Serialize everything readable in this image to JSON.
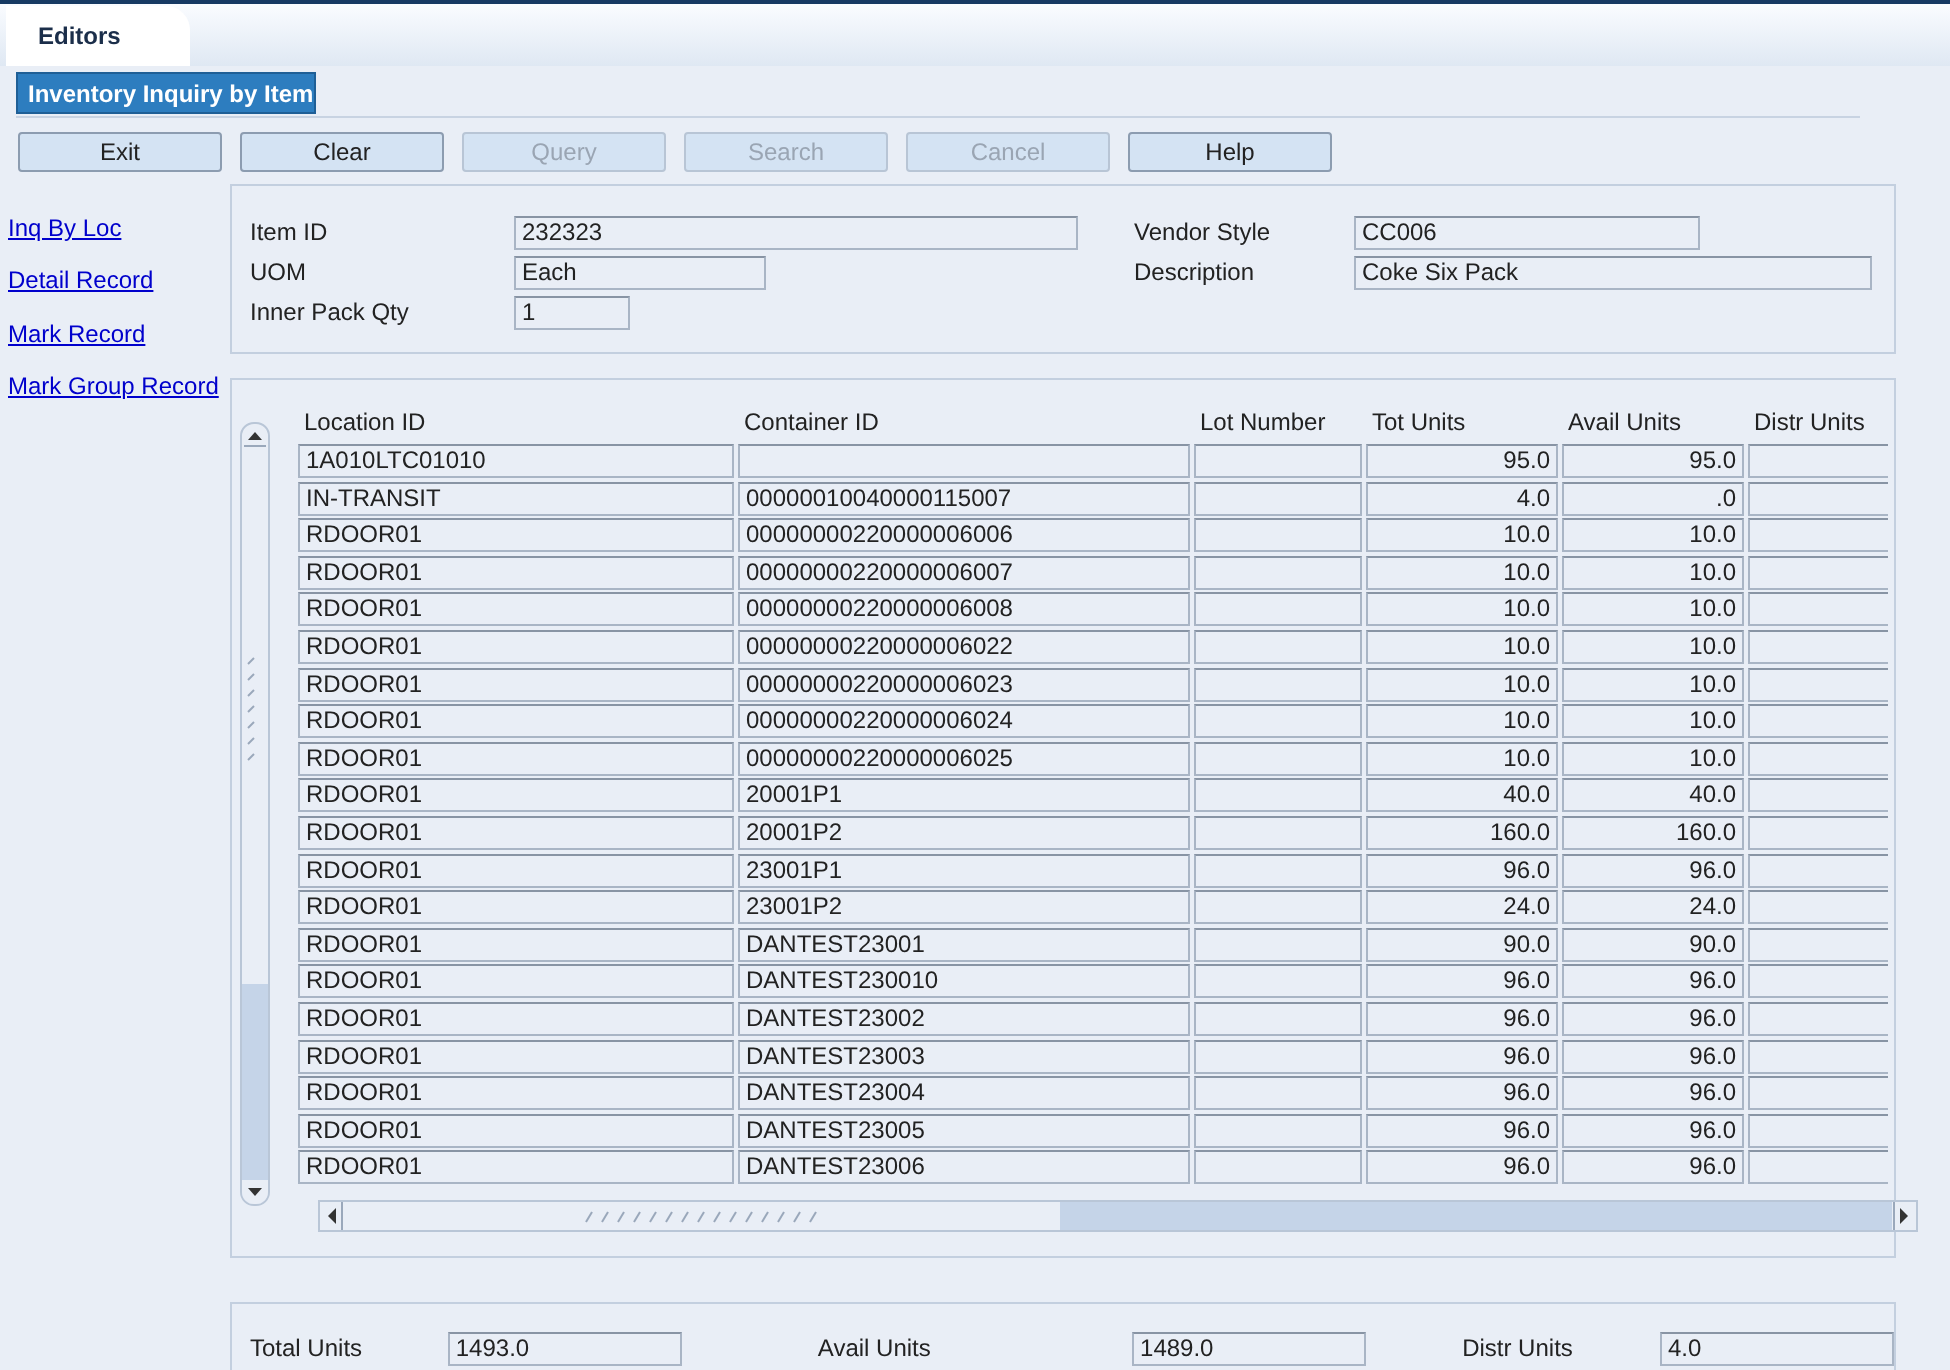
{
  "tabs": [
    {
      "label": "Editors",
      "selected": true
    }
  ],
  "form_title": "Inventory Inquiry by Item",
  "buttons": [
    {
      "label": "Exit",
      "disabled": false
    },
    {
      "label": "Clear",
      "disabled": false
    },
    {
      "label": "Query",
      "disabled": true
    },
    {
      "label": "Search",
      "disabled": true
    },
    {
      "label": "Cancel",
      "disabled": true
    },
    {
      "label": "Help",
      "disabled": false
    }
  ],
  "side_links": [
    "Inq By Loc",
    "Detail Record",
    "Mark Record",
    "Mark Group Record"
  ],
  "header": {
    "item_id": {
      "label": "Item ID",
      "value": "232323"
    },
    "uom": {
      "label": "UOM",
      "value": "Each"
    },
    "inner_pack_qty": {
      "label": "Inner Pack Qty",
      "value": "1"
    },
    "vendor_style": {
      "label": "Vendor Style",
      "value": "CC006"
    },
    "description": {
      "label": "Description",
      "value": "Coke Six Pack"
    }
  },
  "table": {
    "columns": [
      "Location ID",
      "Container ID",
      "Lot Number",
      "Tot Units",
      "Avail Units",
      "Distr Units"
    ],
    "rows": [
      {
        "location_id": "1A010LTC01010",
        "tot_units": "95.0",
        "avail_units": "95.0"
      },
      {
        "location_id": "IN-TRANSIT",
        "container_id": "00000010040000115007",
        "tot_units": "4.0",
        "avail_units": ".0"
      },
      {
        "location_id": "RDOOR01",
        "container_id": "00000000220000006006",
        "tot_units": "10.0",
        "avail_units": "10.0"
      },
      {
        "location_id": "RDOOR01",
        "container_id": "00000000220000006007",
        "tot_units": "10.0",
        "avail_units": "10.0"
      },
      {
        "location_id": "RDOOR01",
        "container_id": "00000000220000006008",
        "tot_units": "10.0",
        "avail_units": "10.0"
      },
      {
        "location_id": "RDOOR01",
        "container_id": "00000000220000006022",
        "tot_units": "10.0",
        "avail_units": "10.0"
      },
      {
        "location_id": "RDOOR01",
        "container_id": "00000000220000006023",
        "tot_units": "10.0",
        "avail_units": "10.0"
      },
      {
        "location_id": "RDOOR01",
        "container_id": "00000000220000006024",
        "tot_units": "10.0",
        "avail_units": "10.0"
      },
      {
        "location_id": "RDOOR01",
        "container_id": "00000000220000006025",
        "tot_units": "10.0",
        "avail_units": "10.0"
      },
      {
        "location_id": "RDOOR01",
        "container_id": "20001P1",
        "tot_units": "40.0",
        "avail_units": "40.0"
      },
      {
        "location_id": "RDOOR01",
        "container_id": "20001P2",
        "tot_units": "160.0",
        "avail_units": "160.0"
      },
      {
        "location_id": "RDOOR01",
        "container_id": "23001P1",
        "tot_units": "96.0",
        "avail_units": "96.0"
      },
      {
        "location_id": "RDOOR01",
        "container_id": "23001P2",
        "tot_units": "24.0",
        "avail_units": "24.0"
      },
      {
        "location_id": "RDOOR01",
        "container_id": "DANTEST23001",
        "tot_units": "90.0",
        "avail_units": "90.0"
      },
      {
        "location_id": "RDOOR01",
        "container_id": "DANTEST230010",
        "tot_units": "96.0",
        "avail_units": "96.0"
      },
      {
        "location_id": "RDOOR01",
        "container_id": "DANTEST23002",
        "tot_units": "96.0",
        "avail_units": "96.0"
      },
      {
        "location_id": "RDOOR01",
        "container_id": "DANTEST23003",
        "tot_units": "96.0",
        "avail_units": "96.0"
      },
      {
        "location_id": "RDOOR01",
        "container_id": "DANTEST23004",
        "tot_units": "96.0",
        "avail_units": "96.0"
      },
      {
        "location_id": "RDOOR01",
        "container_id": "DANTEST23005",
        "tot_units": "96.0",
        "avail_units": "96.0"
      },
      {
        "location_id": "RDOOR01",
        "container_id": "DANTEST23006",
        "tot_units": "96.0",
        "avail_units": "96.0"
      }
    ]
  },
  "totals": [
    {
      "label": "Total Units",
      "value": "1493.0"
    },
    {
      "label": "Avail Units",
      "value": "1489.0"
    },
    {
      "label": "Distr Units",
      "value": "4.0"
    }
  ]
}
